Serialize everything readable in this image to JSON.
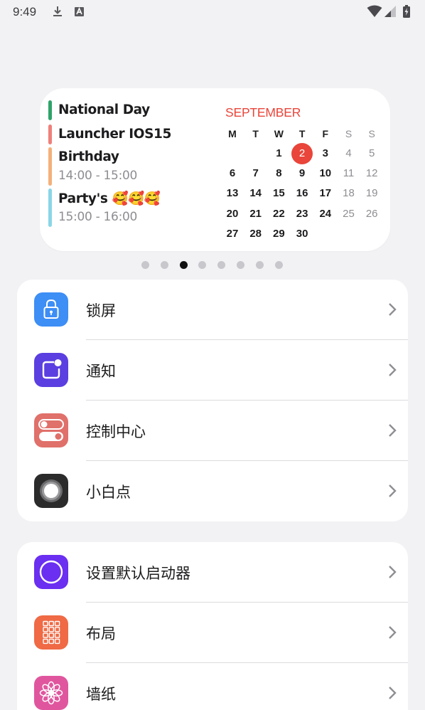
{
  "status_bar": {
    "time": "9:49"
  },
  "widget": {
    "events": [
      {
        "title": "National Day",
        "time": "",
        "color": "#2fa36b"
      },
      {
        "title": "Launcher IOS15",
        "time": "",
        "color": "#ef7f7a"
      },
      {
        "title": "Birthday",
        "time": "14:00 - 15:00",
        "color": "#f4b07a"
      },
      {
        "title": "Party's 🥰🥰🥰",
        "time": "15:00 - 16:00",
        "color": "#8ad6e6"
      }
    ],
    "calendar": {
      "month": "SEPTEMBER",
      "weekdays": [
        "M",
        "T",
        "W",
        "T",
        "F",
        "S",
        "S"
      ],
      "weeks": [
        [
          "",
          "",
          "1",
          "2",
          "3",
          "4",
          "5"
        ],
        [
          "6",
          "7",
          "8",
          "9",
          "10",
          "11",
          "12"
        ],
        [
          "13",
          "14",
          "15",
          "16",
          "17",
          "18",
          "19"
        ],
        [
          "20",
          "21",
          "22",
          "23",
          "24",
          "25",
          "26"
        ],
        [
          "27",
          "28",
          "29",
          "30",
          "",
          "",
          ""
        ]
      ],
      "today": "2",
      "accent_color": "#e9453a"
    }
  },
  "pager": {
    "count": 8,
    "active_index": 2
  },
  "settings": {
    "group1": [
      {
        "label": "锁屏",
        "icon": "lock-icon"
      },
      {
        "label": "通知",
        "icon": "notification-icon"
      },
      {
        "label": "控制中心",
        "icon": "toggle-icon"
      },
      {
        "label": "小白点",
        "icon": "assistive-touch-icon"
      }
    ],
    "group2": [
      {
        "label": "设置默认启动器",
        "icon": "circle-icon"
      },
      {
        "label": "布局",
        "icon": "grid-icon"
      },
      {
        "label": "墙纸",
        "icon": "flower-icon"
      }
    ]
  },
  "colors": {
    "background": "#f2f2f4",
    "card": "#ffffff",
    "lock_icon": "#3d8ef5",
    "notification_icon": "#5b3fe0",
    "control_icon": "#e0706a",
    "assistive_icon": "#2b2b2b",
    "launcher_icon": "#6a2ff0",
    "layout_icon": "#ef6a45",
    "wallpaper_icon": "#e0569e"
  }
}
